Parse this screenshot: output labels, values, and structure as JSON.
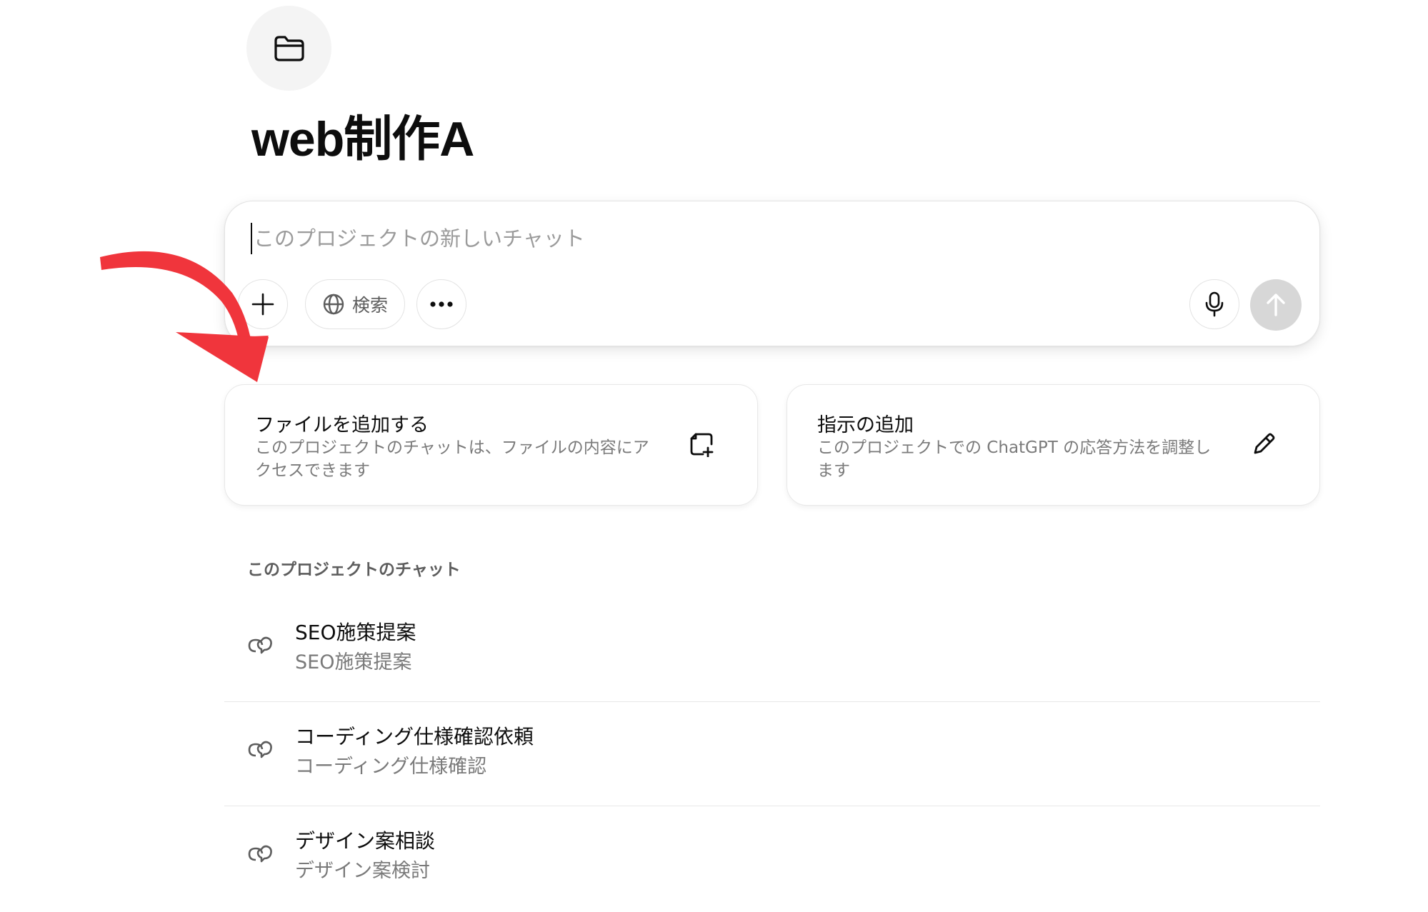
{
  "project": {
    "icon": "folder-icon",
    "title": "web制作A"
  },
  "composer": {
    "placeholder": "このプロジェクトの新しいチャット",
    "value": "",
    "add_icon": "plus-icon",
    "search_label": "検索",
    "search_icon": "globe-icon",
    "more_icon": "ellipsis-icon",
    "mic_icon": "microphone-icon",
    "send_icon": "arrow-up-icon"
  },
  "cards": [
    {
      "title": "ファイルを追加する",
      "description": "このプロジェクトのチャットは、ファイルの内容にアクセスできます",
      "icon": "file-add-icon"
    },
    {
      "title": "指示の追加",
      "description": "このプロジェクトでの ChatGPT の応答方法を調整します",
      "icon": "pencil-icon"
    }
  ],
  "chats_section": {
    "title": "このプロジェクトのチャット",
    "items": [
      {
        "title": "SEO施策提案",
        "subtitle": "SEO施策提案",
        "icon": "chat-bubbles-icon"
      },
      {
        "title": "コーディング仕様確認依頼",
        "subtitle": "コーディング仕様確認",
        "icon": "chat-bubbles-icon"
      },
      {
        "title": "デザイン案相談",
        "subtitle": "デザイン案検討",
        "icon": "chat-bubbles-icon"
      }
    ]
  },
  "annotation": {
    "arrow_color": "#f0353c"
  }
}
